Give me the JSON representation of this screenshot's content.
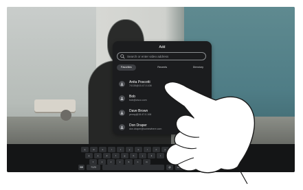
{
  "dialog": {
    "title": "Add",
    "search_placeholder": "Search or enter video address",
    "tabs": [
      {
        "label": "Favorites",
        "active": true
      },
      {
        "label": "Recents",
        "active": false
      },
      {
        "label": "Directory",
        "active": false
      }
    ],
    "contacts": [
      {
        "name": "Anita Poscotti",
        "address": "74135@15.47.0.108"
      },
      {
        "name": "Bob",
        "address": "bob@cisco.com"
      },
      {
        "name": "Dave Brown",
        "address": "yenny@15.47.0.108"
      },
      {
        "name": "Don Draper",
        "address": "don.draper@somewhere.com"
      }
    ]
  },
  "keyboard": {
    "row1": [
      "q",
      "w",
      "e",
      "r",
      "t",
      "y",
      "u",
      "i",
      "o",
      "p"
    ],
    "row2": [
      "a",
      "s",
      "d",
      "f",
      "g",
      "h",
      "j",
      "k",
      "l"
    ],
    "row3": [
      "z",
      "x",
      "c",
      "v",
      "b",
      "n",
      "m"
    ],
    "bottom": {
      "symbols_label": "?123",
      "dot_label": ".com",
      "add_label": "Add"
    }
  },
  "colors": {
    "dialog_bg": "#1b1c1e",
    "add_key": "#1f9c4b",
    "wall": "#4f7d86"
  },
  "icons": {
    "search": "search-icon",
    "avatar": "person-icon",
    "keyboard_toggle": "keyboard-icon"
  }
}
